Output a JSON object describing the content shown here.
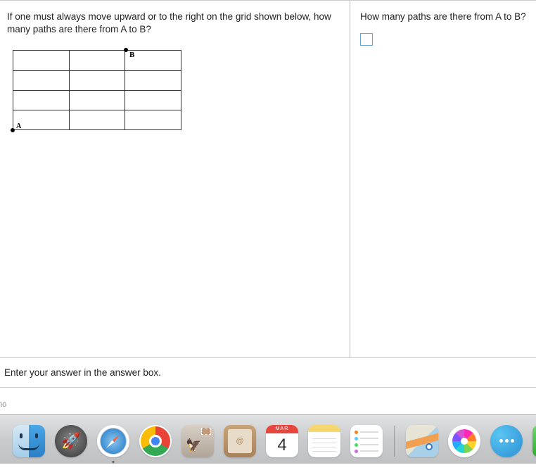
{
  "question": {
    "left_text": "If one must always move upward or to the right on the grid shown below, how many paths are there from A to B?",
    "right_text": "How many paths are there from A to B?",
    "label_A": "A",
    "label_B": "B"
  },
  "instruction": "Enter your answer in the answer box.",
  "truncated_text": "mo",
  "dock": {
    "calendar_month": "MAR",
    "calendar_day": "4",
    "contacts_symbol": "@",
    "reminder_colors": [
      "#f58220",
      "#5ac8fa",
      "#4cd964",
      "#c86dd7"
    ]
  }
}
